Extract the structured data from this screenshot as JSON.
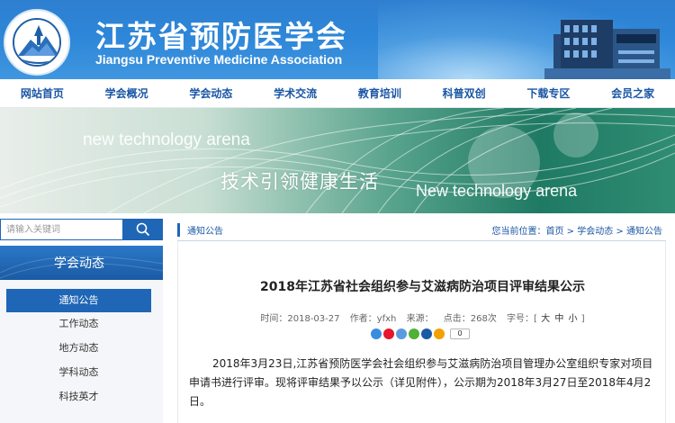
{
  "header": {
    "title": "江苏省预防医学会",
    "subtitle": "Jiangsu Preventive Medicine Association"
  },
  "nav": {
    "items": [
      {
        "label": "网站首页"
      },
      {
        "label": "学会概况"
      },
      {
        "label": "学会动态"
      },
      {
        "label": "学术交流"
      },
      {
        "label": "教育培训"
      },
      {
        "label": "科普双创"
      },
      {
        "label": "下载专区"
      },
      {
        "label": "会员之家"
      }
    ]
  },
  "banner": {
    "text_top": "new technology arena",
    "slogan": "技术引领健康生活",
    "text_bottom": "New technology arena"
  },
  "search": {
    "placeholder": "请输入关键词"
  },
  "sidebar": {
    "title": "学会动态",
    "items": [
      {
        "label": "通知公告",
        "active": true
      },
      {
        "label": "工作动态"
      },
      {
        "label": "地方动态"
      },
      {
        "label": "学科动态"
      },
      {
        "label": "科技英才"
      }
    ]
  },
  "content": {
    "section_label": "通知公告",
    "breadcrumb": {
      "prefix": "您当前位置：",
      "items": [
        "首页",
        "学会动态",
        "通知公告"
      ],
      "separator": " > "
    }
  },
  "article": {
    "title": "2018年江苏省社会组织参与艾滋病防治项目评审结果公示",
    "meta": {
      "time": "时间：2018-03-27",
      "author": "作者：yfxh",
      "source": "来源：",
      "hits": "点击：268次",
      "font_label": "字号：",
      "size_large": "大",
      "size_medium": "中",
      "size_small": "小"
    },
    "share_count": "0",
    "body": "2018年3月23日,江苏省预防医学会社会组织参与艾滋病防治项目管理办公室组织专家对项目申请书进行评审。现将评审结果予以公示（详见附件），公示期为2018年3月27日至2018年4月2日。"
  },
  "colors": {
    "primary": "#1f66b6",
    "nav_text": "#1a56a5",
    "header_bg": "#2f7fd0"
  }
}
